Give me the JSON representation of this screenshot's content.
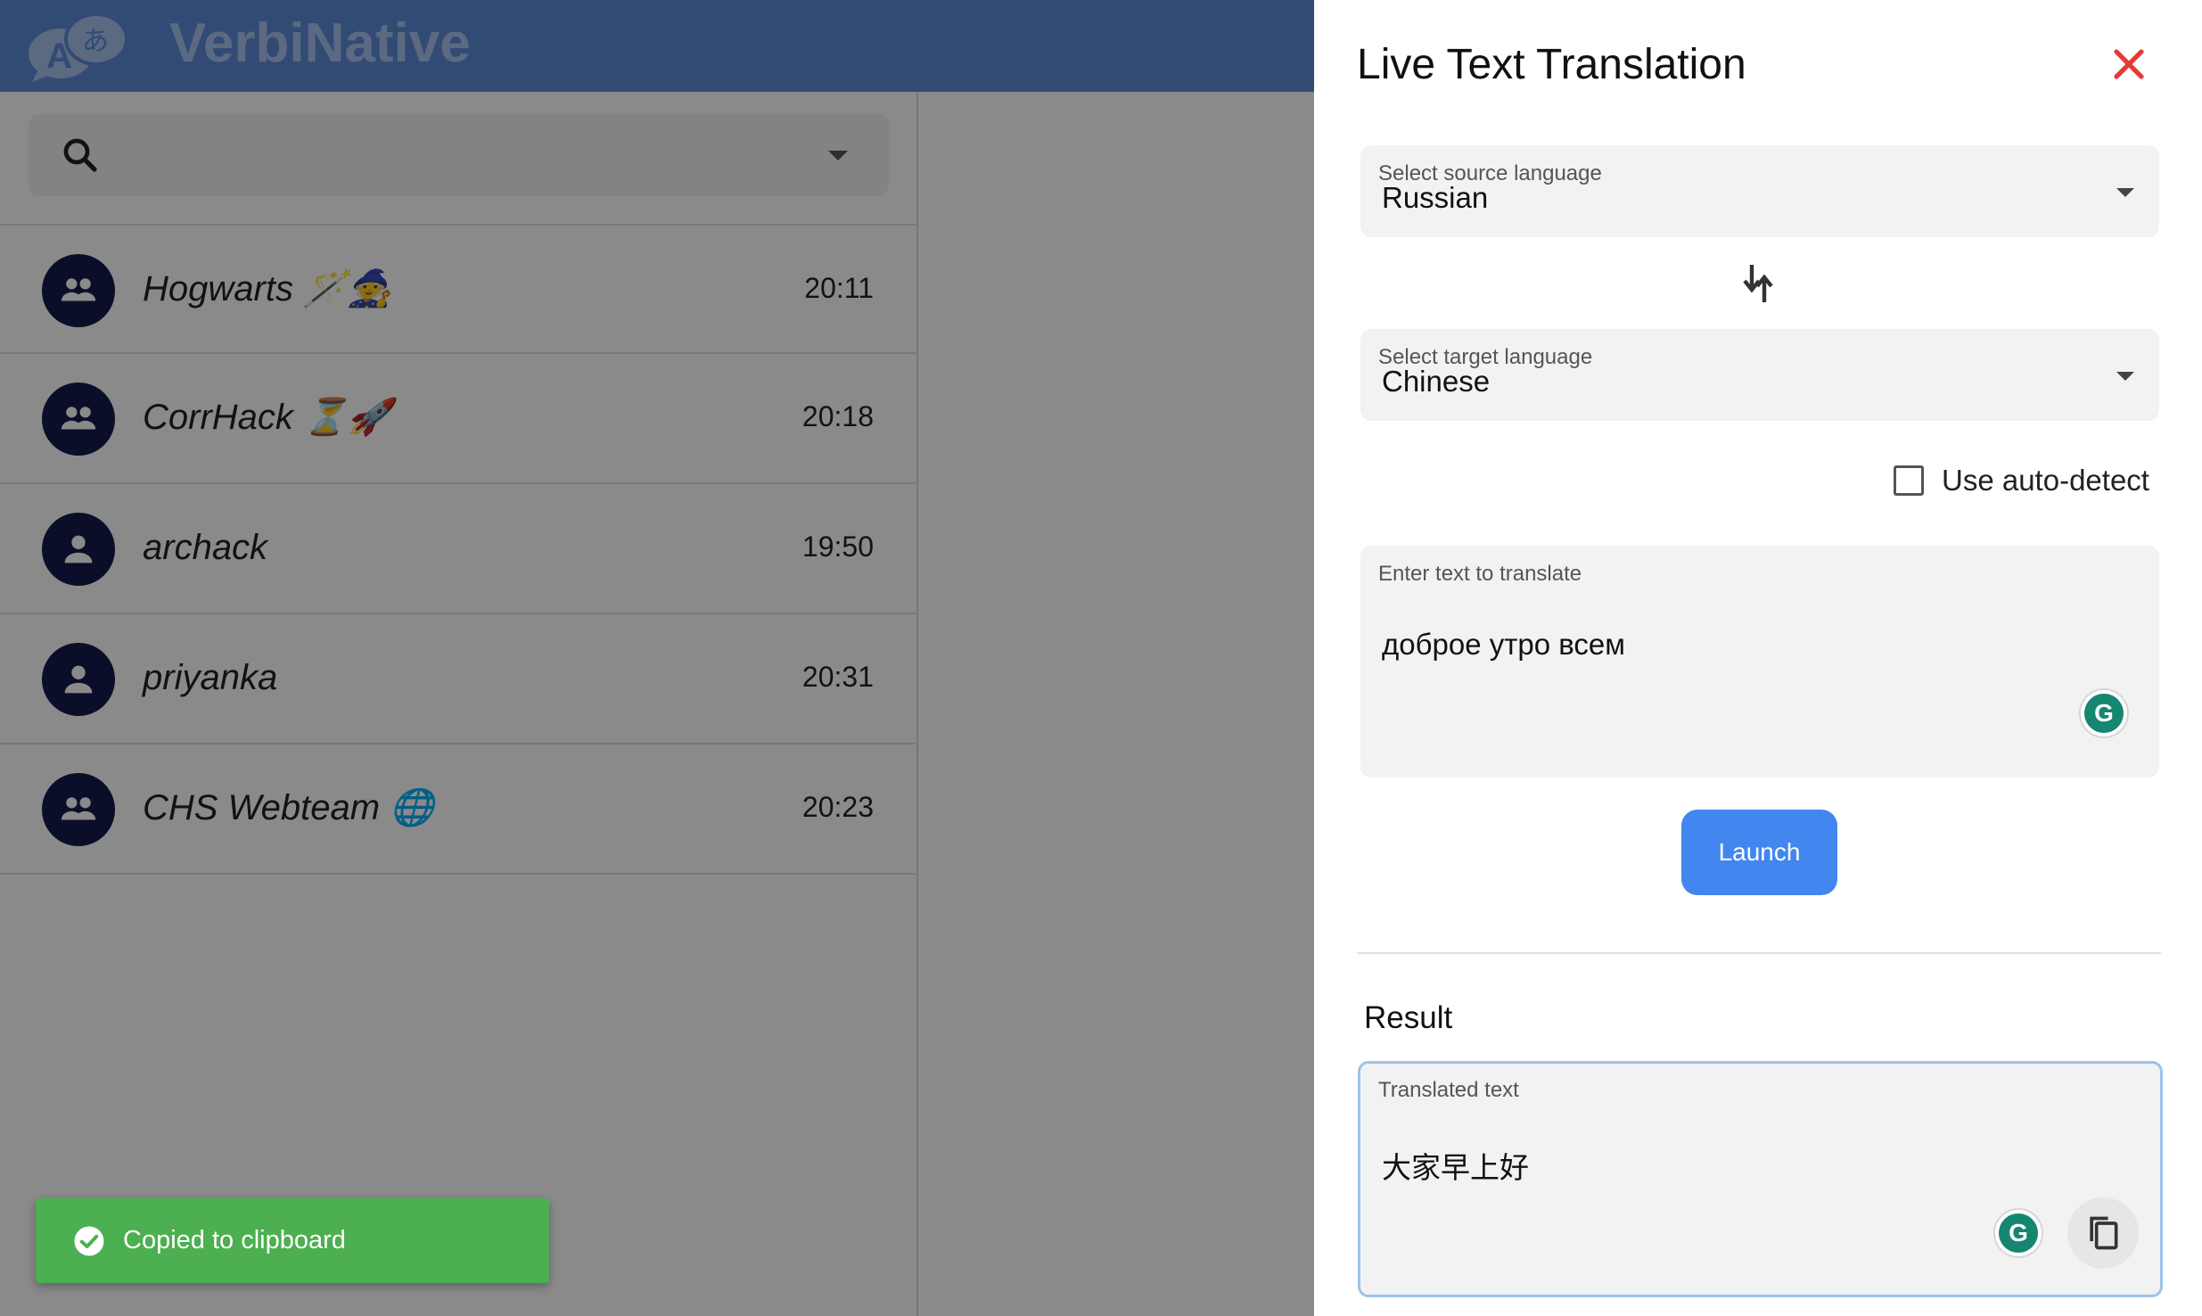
{
  "app": {
    "brand": "VerbiNative",
    "search": {
      "placeholder": ""
    },
    "chats": [
      {
        "name": "Hogwarts 🪄🧙",
        "time": "20:11",
        "type": "group"
      },
      {
        "name": "CorrHack ⏳🚀",
        "time": "20:18",
        "type": "group"
      },
      {
        "name": "archack",
        "time": "19:50",
        "type": "person"
      },
      {
        "name": "priyanka",
        "time": "20:31",
        "type": "person"
      },
      {
        "name": "CHS Webteam 🌐",
        "time": "20:23",
        "type": "group"
      }
    ]
  },
  "snackbar": {
    "message": "Copied to clipboard"
  },
  "drawer": {
    "title": "Live Text Translation",
    "source": {
      "label": "Select source language",
      "value": "Russian"
    },
    "target": {
      "label": "Select target language",
      "value": "Chinese"
    },
    "auto_detect": {
      "label": "Use auto-detect",
      "checked": false
    },
    "input": {
      "label": "Enter text to translate",
      "value": "доброе утро всем"
    },
    "launch_label": "Launch",
    "result": {
      "heading": "Result",
      "label": "Translated text",
      "value": "大家早上好"
    }
  },
  "colors": {
    "topbar": "#5d8bd8",
    "avatar": "#141a4a",
    "launch": "#4187ef",
    "snackbar": "#4caf50",
    "close": "#e53935",
    "grammarly": "#15866f"
  }
}
